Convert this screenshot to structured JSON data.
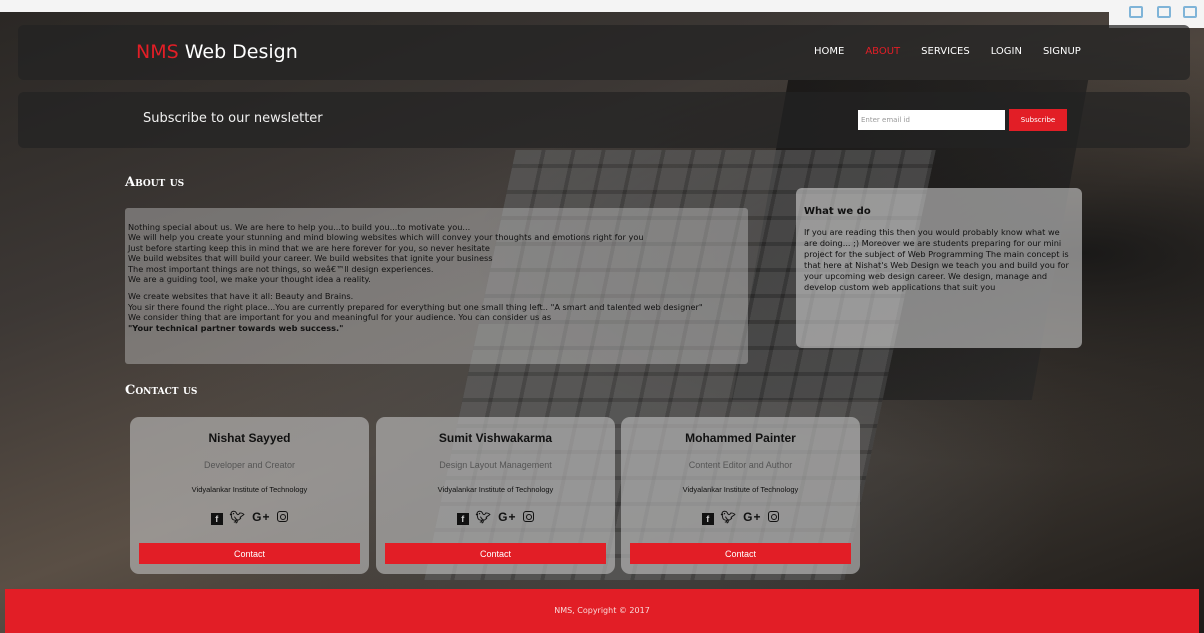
{
  "brand": {
    "accent": "NMS",
    "rest": " Web Design"
  },
  "nav": {
    "items": [
      {
        "label": "HOME"
      },
      {
        "label": "ABOUT"
      },
      {
        "label": "SERVICES"
      },
      {
        "label": "LOGIN"
      },
      {
        "label": "SIGNUP"
      }
    ],
    "active": "ABOUT"
  },
  "newsletter": {
    "title": "Subscribe to our newsletter",
    "placeholder": "Enter email id",
    "button": "Subscribe"
  },
  "about": {
    "title": "About us",
    "para1": [
      "Nothing special about us. We are here to help you...to build you...to motivate you...",
      "We will help you create your stunning and mind blowing websites which will convey your thoughts and emotions right for you",
      "Just before starting keep this in mind that we are here forever for you, so never hesitate",
      "We build websites that will build your career. We build websites that ignite your business",
      "The most important things are not things, so weâ€™ll design experiences.",
      "We are a guiding tool, we make your thought idea a reality."
    ],
    "para2": [
      "We create websites that have it all: Beauty and Brains.",
      "You sir there found the right place...You are currently prepared for everything but one small thing left.. \"A smart and talented web designer\"",
      "We consider thing that are important for you and meaningful for your audience. You can consider us as"
    ],
    "tagline": "\"Your technical partner towards web success.\""
  },
  "whatwedo": {
    "title": "What we do",
    "text": "If you are reading this then you would probably know what we are doing... ;) Moreover we are students preparing for our mini project for the subject of Web Programming The main concept is that here at Nishat's Web Design we teach you and build you for your upcoming web design career. We design, manage and develop custom web applications that suit you"
  },
  "contact": {
    "title": "Contact us",
    "cards": [
      {
        "name": "Nishat Sayyed",
        "role": "Developer and Creator",
        "institute": "Vidyalankar Institute of Technology",
        "button": "Contact"
      },
      {
        "name": "Sumit Vishwakarma",
        "role": "Design Layout Management",
        "institute": "Vidyalankar Institute of Technology",
        "button": "Contact"
      },
      {
        "name": "Mohammed Painter",
        "role": "Content Editor and Author",
        "institute": "Vidyalankar Institute of Technology",
        "button": "Contact"
      }
    ],
    "social_icons": [
      "facebook-icon",
      "twitter-icon",
      "google-plus-icon",
      "instagram-icon"
    ]
  },
  "footer": {
    "text": "NMS, Copyright © 2017"
  },
  "colors": {
    "accent": "#e21e26",
    "panel": "rgba(35,35,35,0.72)",
    "footer": "#e21e26"
  }
}
